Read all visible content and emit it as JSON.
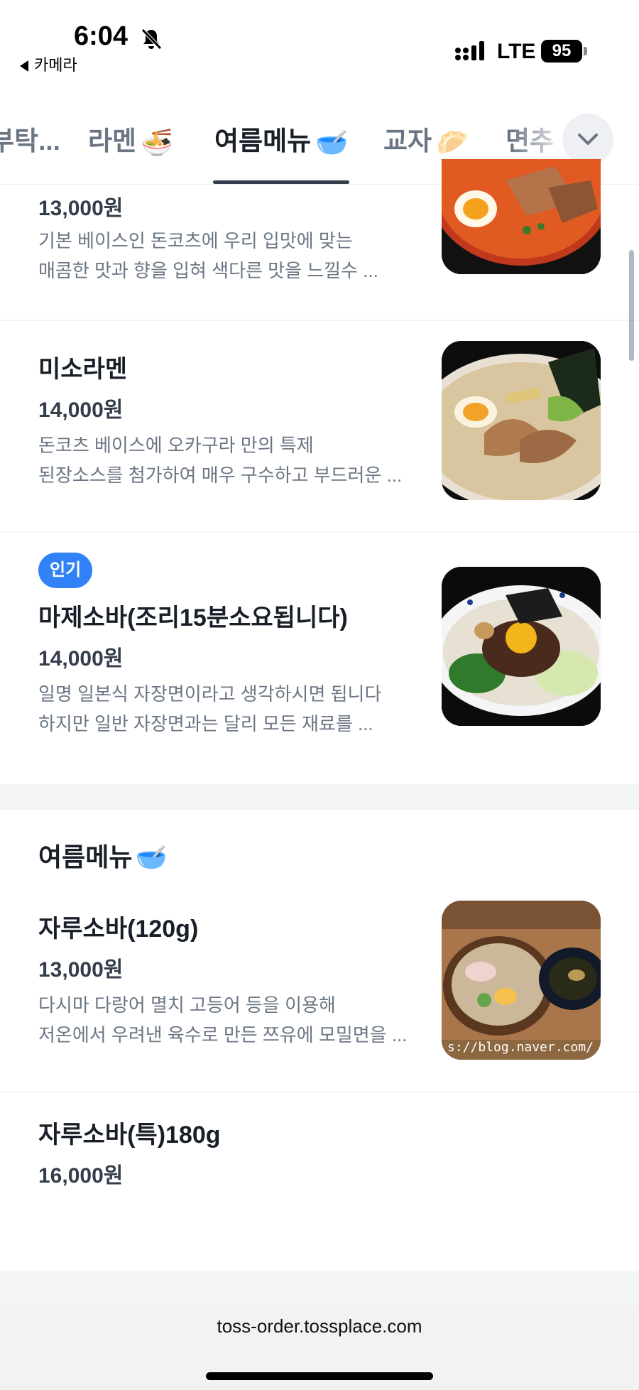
{
  "status_bar": {
    "time": "6:04",
    "back_app": "카메라",
    "network": "LTE",
    "battery": "95"
  },
  "tabs": [
    {
      "label": "부탁...",
      "emoji": ""
    },
    {
      "label": "라멘",
      "emoji": "🍜"
    },
    {
      "label": "여름메뉴",
      "emoji": "🥣"
    },
    {
      "label": "교자",
      "emoji": "🥟"
    },
    {
      "label": "면추",
      "emoji": ""
    }
  ],
  "active_tab": "여름메뉴",
  "items": [
    {
      "price": "13,000원",
      "desc_line1": "기본 베이스인 돈코츠에 우리 입맛에 맞는",
      "desc_line2": "매콤한 맛과 향을 입혀 색다른 맛을 느낄수 ..."
    },
    {
      "name": "미소라멘",
      "price": "14,000원",
      "desc_line1": "돈코츠 베이스에 오카구라 만의 특제",
      "desc_line2": "된장소스를 첨가하여 매우 구수하고 부드러운 ..."
    },
    {
      "badge": "인기",
      "name": "마제소바(조리15분소요됩니다)",
      "price": "14,000원",
      "desc_line1": "일명 일본식 자장면이라고 생각하시면 됩니다",
      "desc_line2": "하지만 일반 자장면과는 달리 모든 재료를 ..."
    }
  ],
  "section": {
    "title": "여름메뉴",
    "emoji": "🥣",
    "items": [
      {
        "name": "자루소바(120g)",
        "price": "13,000원",
        "desc_line1": "다시마 다랑어 멸치 고등어 등을 이용해",
        "desc_line2": "저온에서 우려낸 육수로 만든 쯔유에 모밀면을 ...",
        "image_watermark": "s://blog.naver.com/"
      },
      {
        "name": "자루소바(특)180g",
        "price": "16,000원"
      }
    ]
  },
  "browser": {
    "url": "toss-order.tossplace.com"
  }
}
